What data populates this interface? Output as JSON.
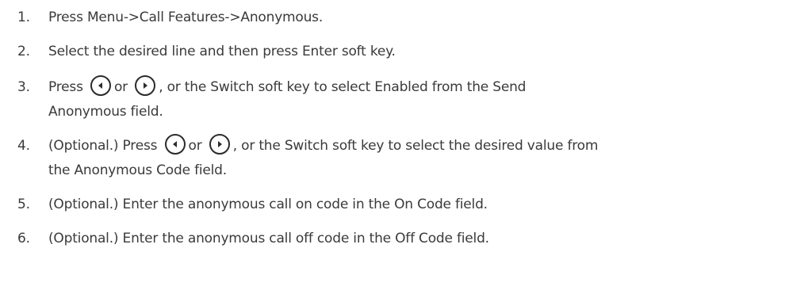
{
  "steps": [
    {
      "number": "1.",
      "lines": [
        "Press Menu->Call Features->Anonymous."
      ]
    },
    {
      "number": "2.",
      "lines": [
        "Select the desired line and then press Enter soft key."
      ]
    },
    {
      "number": "3.",
      "line1_before": "Press",
      "line1_or": "or",
      "line1_after": ", or the Switch soft key to select Enabled from the Send",
      "line2": "Anonymous field.",
      "icons": [
        "left-navigation-key-icon",
        "right-navigation-key-icon"
      ]
    },
    {
      "number": "4.",
      "line1_before": "(Optional.) Press",
      "line1_or": "or",
      "line1_after": ", or the Switch soft key to select the desired value from",
      "line2": "the Anonymous Code field.",
      "icons": [
        "left-navigation-key-icon",
        "right-navigation-key-icon"
      ]
    },
    {
      "number": "5.",
      "lines": [
        "(Optional.) Enter the anonymous call on code in the On Code field."
      ]
    },
    {
      "number": "6.",
      "lines": [
        "(Optional.) Enter the anonymous call off code in the Off Code field."
      ]
    }
  ]
}
